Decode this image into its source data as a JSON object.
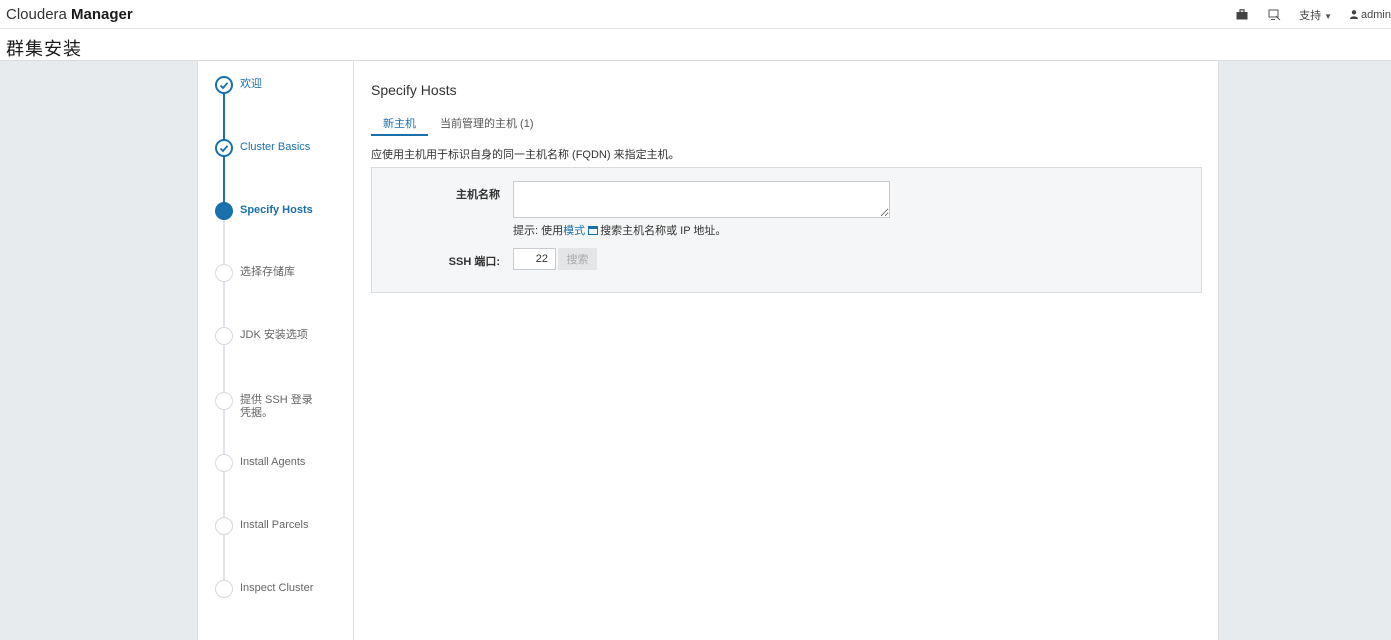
{
  "header": {
    "brand_light": "Cloudera",
    "brand_bold": "Manager",
    "nav": {
      "support_label": "支持",
      "user_label": "admin",
      "icons": [
        "briefcase-icon",
        "tour-icon",
        "caret-down-icon",
        "user-icon"
      ]
    }
  },
  "page_title": "群集安装",
  "steps": [
    {
      "label": "欢迎",
      "state": "done"
    },
    {
      "label": "Cluster Basics",
      "state": "done"
    },
    {
      "label": "Specify Hosts",
      "state": "active"
    },
    {
      "label": "选择存储库",
      "state": "todo"
    },
    {
      "label": "JDK 安装选项",
      "state": "todo"
    },
    {
      "label": "提供 SSH 登录凭据。",
      "state": "todo"
    },
    {
      "label": "Install Agents",
      "state": "todo"
    },
    {
      "label": "Install Parcels",
      "state": "todo"
    },
    {
      "label": "Inspect Cluster",
      "state": "todo"
    }
  ],
  "main": {
    "section_title": "Specify Hosts",
    "tabs": [
      {
        "label": "新主机",
        "active": true
      },
      {
        "label": "当前管理的主机 (1)",
        "active": false
      }
    ],
    "description": "应使用主机用于标识自身的同一主机名称 (FQDN) 来指定主机。",
    "form": {
      "hosts_label": "主机名称",
      "hosts_value": "",
      "hint_prefix": "提示: 使用",
      "hint_link": "模式",
      "hint_suffix": "搜索主机名称或 IP 地址。",
      "ssh_label": "SSH 端口:",
      "ssh_port_value": "22",
      "search_button": "搜索"
    }
  },
  "colors": {
    "accent": "#1a6fad",
    "page_bg": "#e8ebee",
    "panel_bg": "#f5f6f7",
    "todo_gray": "#d6d9dd"
  }
}
